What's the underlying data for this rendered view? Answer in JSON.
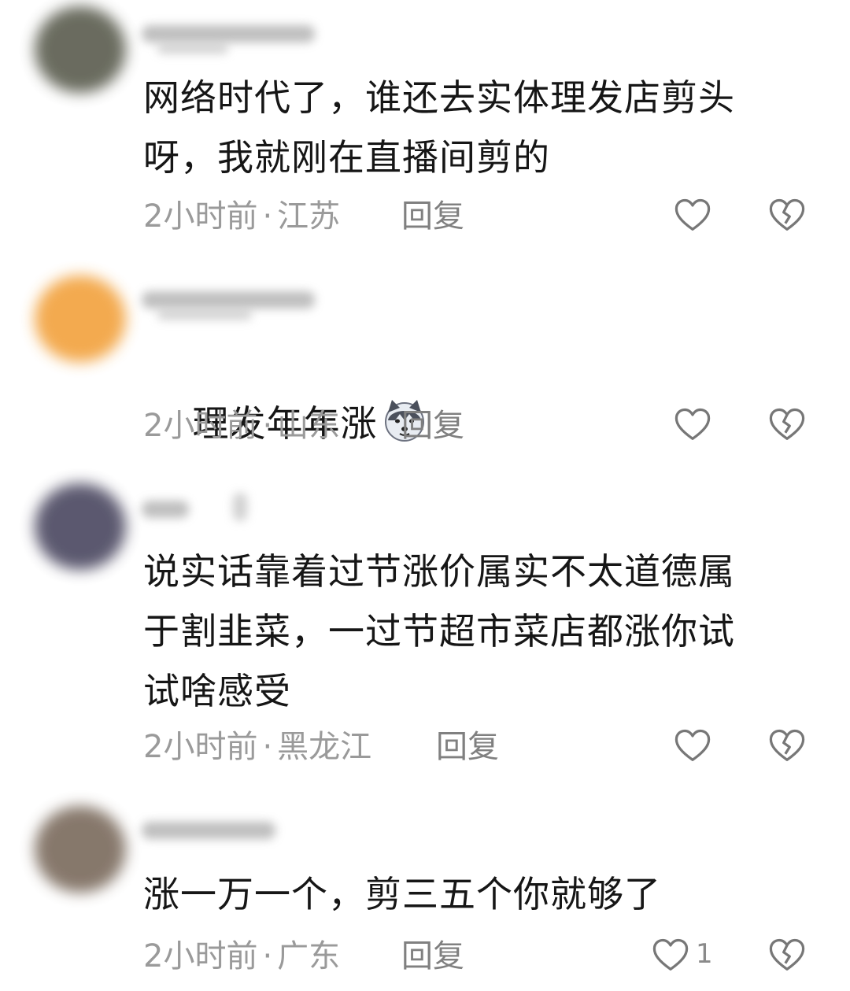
{
  "comments": [
    {
      "text": "网络时代了，谁还去实体理发店剪头\n呀，我就刚在直播间剪的",
      "time": "2小时前",
      "location": "江苏",
      "reply_label": "回复",
      "like_icon": "heart-outline-icon",
      "dislike_icon": "broken-heart-icon",
      "avatar_color": "#5a5c4e"
    },
    {
      "text": "理发年年涨",
      "emoji_icon": "husky-dog-emoji",
      "time": "2小时前",
      "location": "山东",
      "reply_label": "回复",
      "like_icon": "heart-outline-icon",
      "dislike_icon": "broken-heart-icon",
      "avatar_color": "#f2a13c"
    },
    {
      "text": "说实话靠着过节涨价属实不太道德属\n于割韭菜，一过节超市菜店都涨你试\n试啥感受",
      "time": "2小时前",
      "location": "黑龙江",
      "reply_label": "回复",
      "like_icon": "heart-outline-icon",
      "dislike_icon": "broken-heart-icon",
      "avatar_color": "#4a4760"
    },
    {
      "text": "涨一万一个，剪三五个你就够了",
      "time": "2小时前",
      "location": "广东",
      "reply_label": "回复",
      "like_count": "1",
      "like_icon": "heart-outline-icon",
      "dislike_icon": "broken-heart-icon",
      "avatar_color": "#7a6a5c"
    }
  ],
  "meta_separator": "·"
}
